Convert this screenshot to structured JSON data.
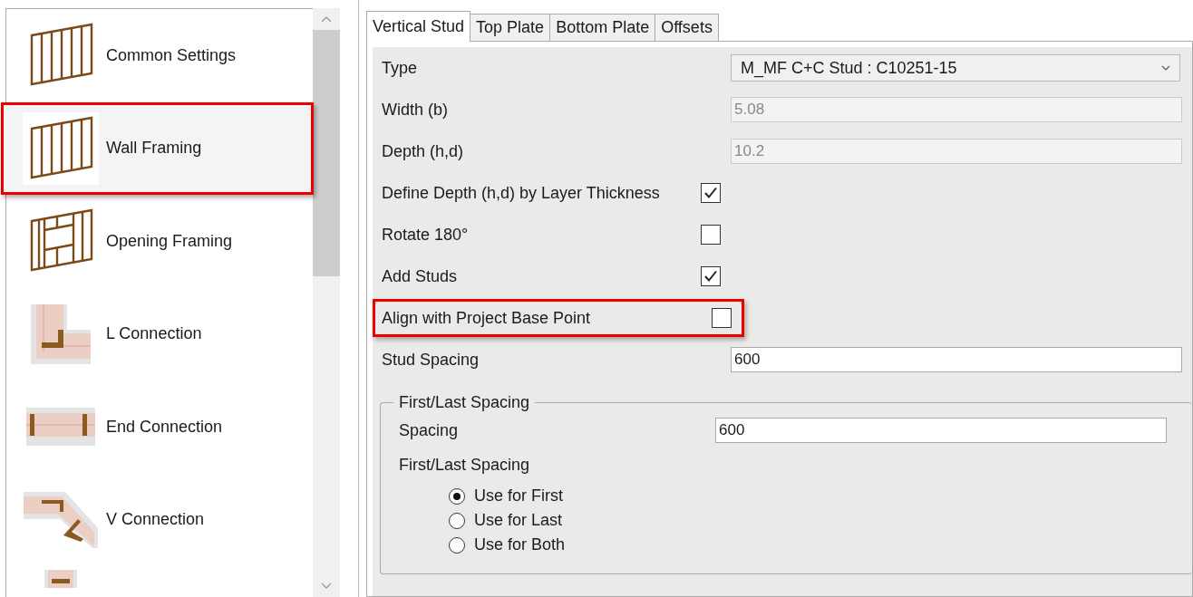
{
  "sidebar": {
    "items": [
      {
        "kind": "wall",
        "label": "Common Settings",
        "selected": false,
        "highlighted": false
      },
      {
        "kind": "wall",
        "label": "Wall Framing",
        "selected": true,
        "highlighted": true
      },
      {
        "kind": "opening",
        "label": "Opening Framing",
        "selected": false,
        "highlighted": false
      },
      {
        "kind": "l",
        "label": "L Connection",
        "selected": false,
        "highlighted": false
      },
      {
        "kind": "end",
        "label": "End Connection",
        "selected": false,
        "highlighted": false
      },
      {
        "kind": "v",
        "label": "V Connection",
        "selected": false,
        "highlighted": false
      },
      {
        "kind": "t",
        "selected": false,
        "highlighted": false
      }
    ]
  },
  "tabs": [
    {
      "label": "Vertical Stud",
      "selected": true
    },
    {
      "label": "Top Plate",
      "selected": false
    },
    {
      "label": "Bottom Plate",
      "selected": false
    },
    {
      "label": "Offsets",
      "selected": false
    }
  ],
  "properties": [
    {
      "kind": "dropdown",
      "label": "Type",
      "value": "M_MF C+C Stud : C10251-15",
      "highlighted": false
    },
    {
      "kind": "field",
      "label": "Width (b)",
      "value": "5.08",
      "disabled": true,
      "highlighted": false
    },
    {
      "kind": "field",
      "label": "Depth (h,d)",
      "value": "10.2",
      "disabled": true,
      "highlighted": false
    },
    {
      "kind": "checkbox",
      "label": "Define Depth (h,d) by Layer Thickness",
      "checked": true,
      "highlighted": false
    },
    {
      "kind": "checkbox",
      "label": "Rotate 180°",
      "checked": false,
      "highlighted": false
    },
    {
      "kind": "checkbox",
      "label": "Add Studs",
      "checked": true,
      "highlighted": false
    },
    {
      "kind": "checkbox",
      "label": "Align with Project Base Point",
      "checked": false,
      "highlighted": true
    },
    {
      "kind": "field",
      "label": "Stud Spacing",
      "value": "600",
      "disabled": false,
      "highlighted": false
    }
  ],
  "group": {
    "title": "First/Last Spacing",
    "spacing_label": "Spacing",
    "spacing_value": "600",
    "option_label": "First/Last Spacing",
    "options": [
      {
        "label": "Use for First",
        "selected": true
      },
      {
        "label": "Use for Last",
        "selected": false
      },
      {
        "label": "Use for Both",
        "selected": false
      }
    ]
  }
}
